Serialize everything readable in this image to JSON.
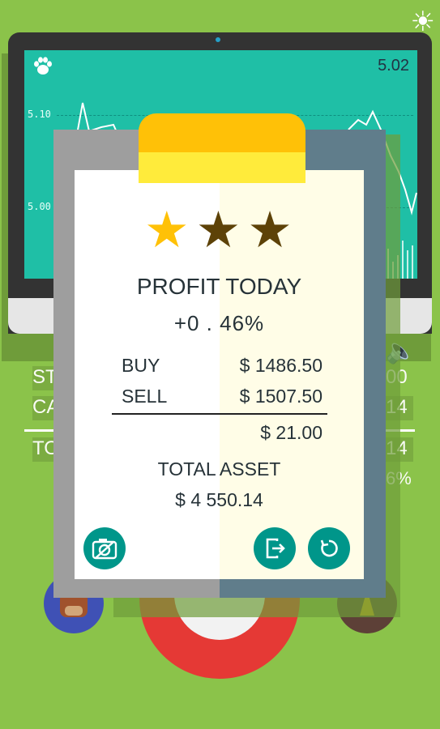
{
  "screen": {
    "price": "5.02",
    "ylabels": [
      "5.10",
      "5.00"
    ],
    "paw_icon": "paw-icon"
  },
  "background_stats": {
    "left_labels": [
      "ST",
      "CA",
      "TO"
    ],
    "right_values": [
      "00",
      "14",
      "14",
      "6%"
    ]
  },
  "rating": {
    "total_stars": 3,
    "filled_stars": 1,
    "filled_color": "#ffc107",
    "empty_color": "#5d4207"
  },
  "report": {
    "title": "PROFIT TODAY",
    "percent": "+0 . 46%",
    "buy_label": "BUY",
    "buy_value": "$ 1486.50",
    "sell_label": "SELL",
    "sell_value": "$ 1507.50",
    "difference": "$ 21.00",
    "total_asset_label": "TOTAL ASSET",
    "total_asset_value": "$ 4 550.14"
  },
  "buttons": {
    "screenshot_icon": "camera-icon",
    "exit_icon": "exit-icon",
    "restart_icon": "restart-icon"
  },
  "colors": {
    "background": "#8bc34a",
    "screen": "#1fbfa6",
    "accent": "#00968a",
    "clip": "#ffc107"
  }
}
